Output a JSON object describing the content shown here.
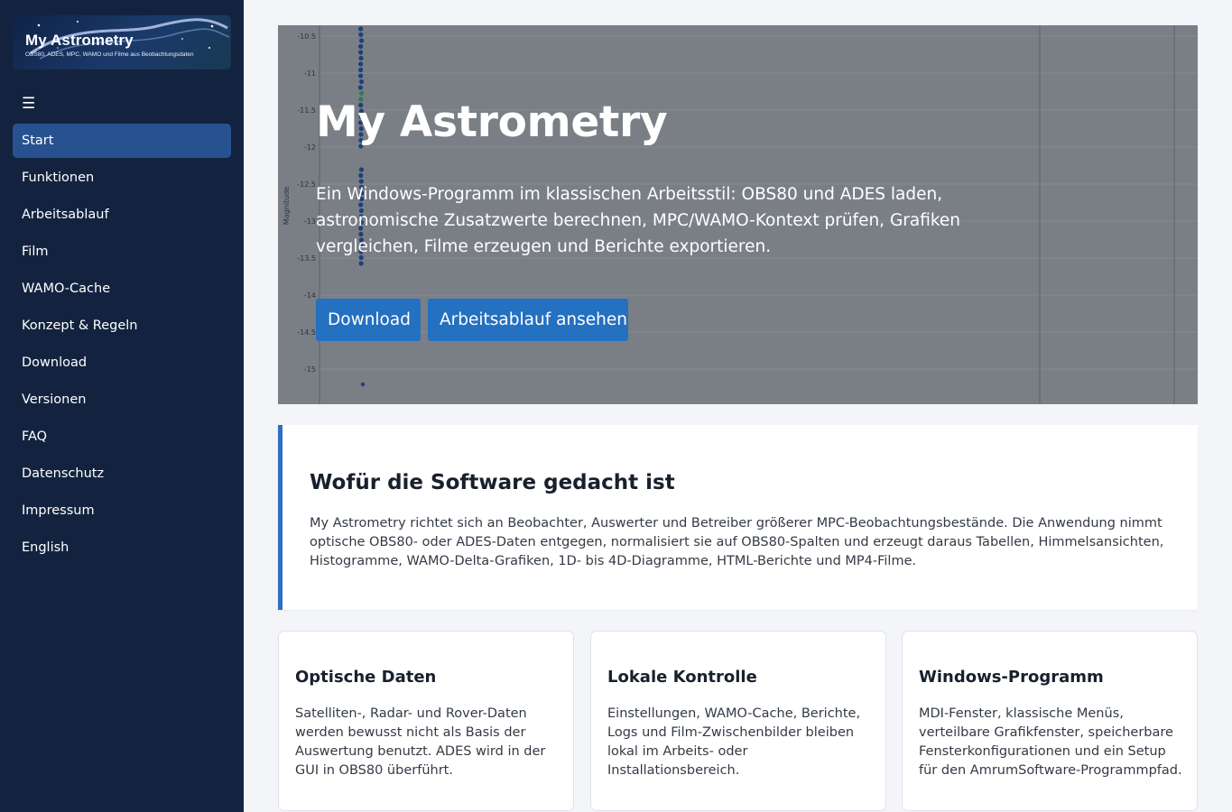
{
  "logo": {
    "title": "My Astrometry",
    "subtitle": "OBS80, ADES, MPC, WAMO und Filme aus Beobachtungsdaten"
  },
  "menu_icon": "hamburger-menu-icon",
  "nav": {
    "items": [
      {
        "label": "Start",
        "active": true
      },
      {
        "label": "Funktionen"
      },
      {
        "label": "Arbeitsablauf"
      },
      {
        "label": "Film"
      },
      {
        "label": "WAMO-Cache"
      },
      {
        "label": "Konzept & Regeln"
      },
      {
        "label": "Download"
      },
      {
        "label": "Versionen"
      },
      {
        "label": "FAQ"
      },
      {
        "label": "Datenschutz"
      },
      {
        "label": "Impressum"
      },
      {
        "label": "English"
      }
    ]
  },
  "hero": {
    "title": "My Astrometry",
    "text": "Ein Windows-Programm im klassischen Arbeitsstil: OBS80 und ADES laden, astronomische Zusatzwerte berechnen, MPC/WAMO-Kontext prüfen, Grafiken vergleichen, Filme erzeugen und Berichte exportieren.",
    "buttons": {
      "download": "Download",
      "workflow": "Arbeitsablauf ansehen"
    },
    "background_plot": {
      "ylabel": "Magnitude",
      "yticks": [
        "-10.5",
        "-11",
        "-11.5",
        "-12",
        "-12.5",
        "-13",
        "-13.5",
        "-14",
        "-14.5",
        "-15"
      ]
    }
  },
  "intro": {
    "heading": "Wofür die Software gedacht ist",
    "text": "My Astrometry richtet sich an Beobachter, Auswerter und Betreiber größerer MPC-Beobachtungsbestände. Die Anwendung nimmt optische OBS80- oder ADES-Daten entgegen, normalisiert sie auf OBS80-Spalten und erzeugt daraus Tabellen, Himmelsansichten, Histogramme, WAMO-Delta-Grafiken, 1D- bis 4D-Diagramme, HTML-Berichte und MP4-Filme."
  },
  "cards": [
    {
      "title": "Optische Daten",
      "text": "Satelliten-, Radar- und Rover-Daten werden bewusst nicht als Basis der Auswertung benutzt. ADES wird in der GUI in OBS80 überführt."
    },
    {
      "title": "Lokale Kontrolle",
      "text": "Einstellungen, WAMO-Cache, Berichte, Logs und Film-Zwischenbilder bleiben lokal im Arbeits- oder Installationsbereich."
    },
    {
      "title": "Windows-Programm",
      "text": "MDI-Fenster, klassische Menüs, verteilbare Grafikfenster, speicherbare Fensterkonfigurationen und ein Setup für den AmrumSoftware-Programmpfad."
    }
  ],
  "colors": {
    "sidebar": "#13233f",
    "nav_active": "#28528f",
    "accent": "#2470c1",
    "intro_border": "#2e6fc2",
    "hero_overlay": "#7a7f86"
  }
}
